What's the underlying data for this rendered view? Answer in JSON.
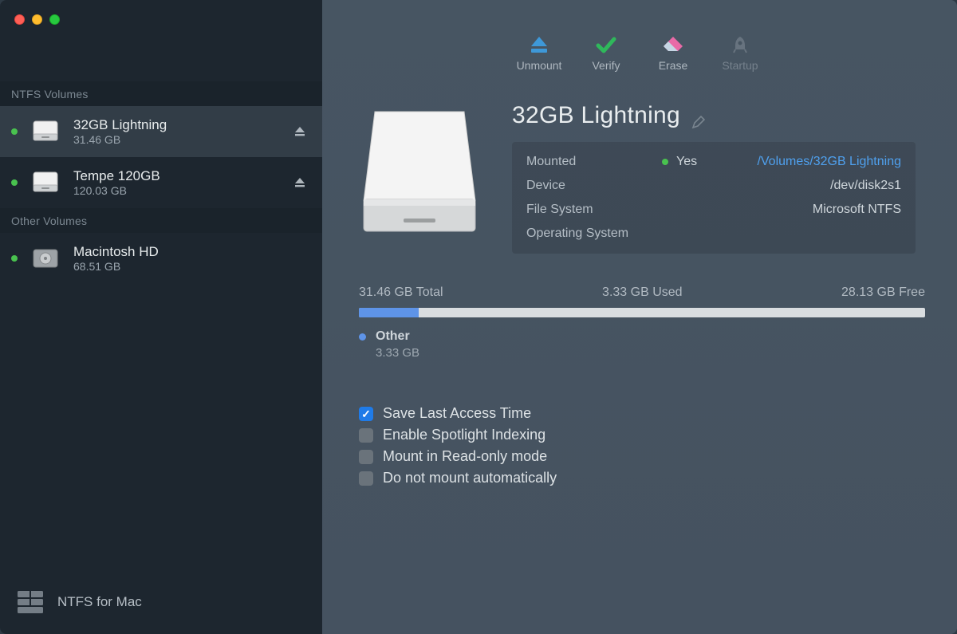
{
  "sidebar": {
    "sections": [
      {
        "title": "NTFS Volumes",
        "items": [
          {
            "name": "32GB Lightning",
            "sub": "31.46 GB",
            "eject": true,
            "selected": true
          },
          {
            "name": "Tempe 120GB",
            "sub": "120.03 GB",
            "eject": true,
            "selected": false
          }
        ]
      },
      {
        "title": "Other Volumes",
        "items": [
          {
            "name": "Macintosh HD",
            "sub": "68.51 GB",
            "eject": false,
            "selected": false
          }
        ]
      }
    ],
    "footer": "NTFS for Mac"
  },
  "toolbar": {
    "items": [
      {
        "id": "unmount",
        "label": "Unmount",
        "disabled": false
      },
      {
        "id": "verify",
        "label": "Verify",
        "disabled": false
      },
      {
        "id": "erase",
        "label": "Erase",
        "disabled": false
      },
      {
        "id": "startup",
        "label": "Startup",
        "disabled": true
      }
    ]
  },
  "detail": {
    "title": "32GB Lightning",
    "rows": {
      "mounted_label": "Mounted",
      "mounted_value": "Yes",
      "mounted_path": "/Volumes/32GB Lightning",
      "device_label": "Device",
      "device_value": "/dev/disk2s1",
      "fs_label": "File System",
      "fs_value": "Microsoft NTFS",
      "os_label": "Operating System",
      "os_value": ""
    }
  },
  "usage": {
    "total": "31.46 GB Total",
    "used": "3.33 GB Used",
    "free": "28.13 GB Free",
    "percent_used": 10.6,
    "legend": {
      "label": "Other",
      "value": "3.33 GB"
    }
  },
  "options": [
    {
      "label": "Save Last Access Time",
      "checked": true
    },
    {
      "label": "Enable Spotlight Indexing",
      "checked": false
    },
    {
      "label": "Mount in Read-only mode",
      "checked": false
    },
    {
      "label": "Do not mount automatically",
      "checked": false
    }
  ]
}
